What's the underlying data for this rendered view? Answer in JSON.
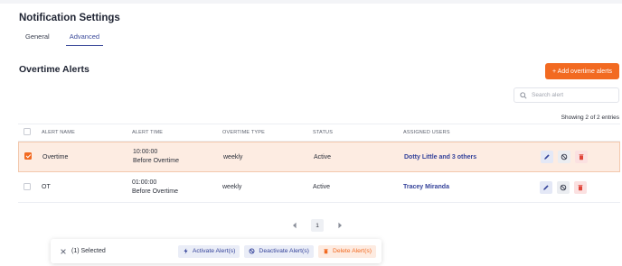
{
  "page": {
    "title": "Notification Settings",
    "tabs": [
      {
        "label": "General"
      },
      {
        "label": "Advanced"
      }
    ],
    "section_title": "Overtime Alerts",
    "add_button": "+ Add overtime alerts",
    "search": {
      "placeholder": "Search alert"
    },
    "entries_text": "Showing 2 of 2 entries"
  },
  "table": {
    "headers": {
      "name": "ALERT NAME",
      "time": "ALERT TIME",
      "type": "OVERTIME TYPE",
      "status": "STATUS",
      "users": "ASSIGNED USERS"
    },
    "rows": [
      {
        "name": "Overtime",
        "time": "10:00:00",
        "time_sub": "Before Overtime",
        "type": "weekly",
        "status": "Active",
        "users": "Dotty Little and 3 others"
      },
      {
        "name": "OT",
        "time": "01:00:00",
        "time_sub": "Before Overtime",
        "type": "weekly",
        "status": "Active",
        "users": "Tracey Miranda"
      }
    ]
  },
  "pagination": {
    "current": "1"
  },
  "bulk": {
    "selected": "(1) Selected",
    "activate": "Activate Alert(s)",
    "deactivate": "Deactivate Alert(s)",
    "delete": "Delete Alert(s)"
  },
  "colors": {
    "accent": "#f26a21",
    "primary": "#34429a",
    "danger": "#e0453a"
  }
}
